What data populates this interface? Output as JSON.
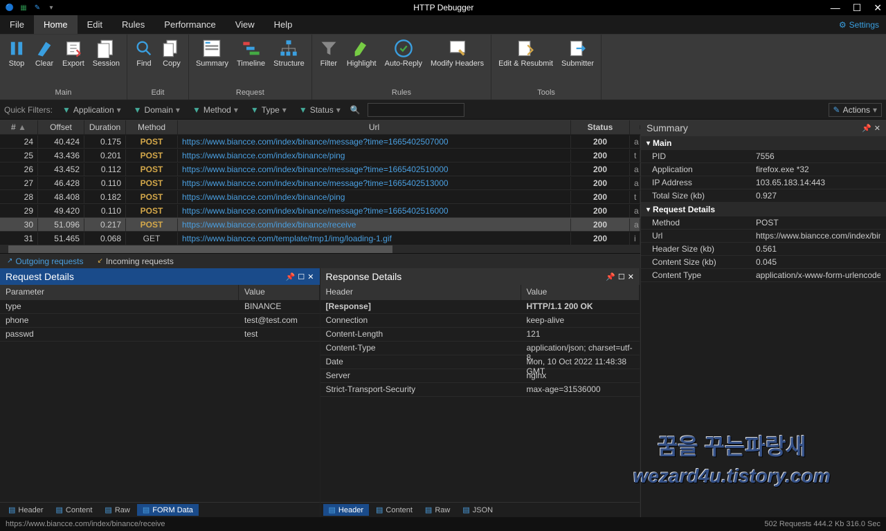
{
  "app": {
    "title": "HTTP Debugger"
  },
  "menu": {
    "items": [
      "File",
      "Home",
      "Edit",
      "Rules",
      "Performance",
      "View",
      "Help"
    ],
    "active": 1,
    "settings": "Settings"
  },
  "ribbon": {
    "groups": [
      {
        "label": "Main",
        "buttons": [
          {
            "name": "stop",
            "label": "Stop"
          },
          {
            "name": "clear",
            "label": "Clear"
          },
          {
            "name": "export",
            "label": "Export"
          },
          {
            "name": "session",
            "label": "Session"
          }
        ]
      },
      {
        "label": "Edit",
        "buttons": [
          {
            "name": "find",
            "label": "Find"
          },
          {
            "name": "copy",
            "label": "Copy"
          }
        ]
      },
      {
        "label": "Request",
        "buttons": [
          {
            "name": "summary",
            "label": "Summary"
          },
          {
            "name": "timeline",
            "label": "Timeline"
          },
          {
            "name": "structure",
            "label": "Structure"
          }
        ]
      },
      {
        "label": "Rules",
        "buttons": [
          {
            "name": "filter",
            "label": "Filter"
          },
          {
            "name": "highlight",
            "label": "Highlight"
          },
          {
            "name": "autoreply",
            "label": "Auto-Reply"
          },
          {
            "name": "modify",
            "label": "Modify\nHeaders"
          }
        ]
      },
      {
        "label": "Tools",
        "buttons": [
          {
            "name": "edit-resubmit",
            "label": "Edit &\nResubmit"
          },
          {
            "name": "submitter",
            "label": "Submitter"
          }
        ]
      }
    ]
  },
  "filters": {
    "label": "Quick Filters:",
    "dropdowns": [
      "Application",
      "Domain",
      "Method",
      "Type",
      "Status"
    ],
    "actions": "Actions"
  },
  "grid": {
    "headers": [
      "#",
      "Offset",
      "Duration",
      "Method",
      "Url",
      "Status"
    ],
    "rows": [
      {
        "n": "24",
        "off": "40.424",
        "dur": "0.175",
        "met": "POST",
        "url": "https://www.biancce.com/index/binance/message?time=1665402507000",
        "stat": "200",
        "e": "a"
      },
      {
        "n": "25",
        "off": "43.436",
        "dur": "0.201",
        "met": "POST",
        "url": "https://www.biancce.com/index/binance/ping",
        "stat": "200",
        "e": "t"
      },
      {
        "n": "26",
        "off": "43.452",
        "dur": "0.112",
        "met": "POST",
        "url": "https://www.biancce.com/index/binance/message?time=1665402510000",
        "stat": "200",
        "e": "a"
      },
      {
        "n": "27",
        "off": "46.428",
        "dur": "0.110",
        "met": "POST",
        "url": "https://www.biancce.com/index/binance/message?time=1665402513000",
        "stat": "200",
        "e": "a"
      },
      {
        "n": "28",
        "off": "48.408",
        "dur": "0.182",
        "met": "POST",
        "url": "https://www.biancce.com/index/binance/ping",
        "stat": "200",
        "e": "t"
      },
      {
        "n": "29",
        "off": "49.420",
        "dur": "0.110",
        "met": "POST",
        "url": "https://www.biancce.com/index/binance/message?time=1665402516000",
        "stat": "200",
        "e": "a"
      },
      {
        "n": "30",
        "off": "51.096",
        "dur": "0.217",
        "met": "POST",
        "url": "https://www.biancce.com/index/binance/receive",
        "stat": "200",
        "e": "a",
        "sel": true
      },
      {
        "n": "31",
        "off": "51.465",
        "dur": "0.068",
        "met": "GET",
        "url": "https://www.biancce.com/template/tmp1/img/loading-1.gif",
        "stat": "200",
        "e": "i"
      }
    ]
  },
  "reqtabs": {
    "outgoing": "Outgoing requests",
    "incoming": "Incoming requests"
  },
  "reqdetails": {
    "title": "Request Details",
    "headers": [
      "Parameter",
      "Value"
    ],
    "rows": [
      {
        "k": "type",
        "v": "BINANCE"
      },
      {
        "k": "phone",
        "v": "test@test.com"
      },
      {
        "k": "passwd",
        "v": "test"
      }
    ],
    "tabs": [
      "Header",
      "Content",
      "Raw",
      "FORM Data"
    ],
    "active_tab": 3
  },
  "respdetails": {
    "title": "Response Details",
    "headers": [
      "Header",
      "Value"
    ],
    "rows": [
      {
        "k": "[Response]",
        "v": "HTTP/1.1 200 OK",
        "bold": true
      },
      {
        "k": "Connection",
        "v": "keep-alive"
      },
      {
        "k": "Content-Length",
        "v": "121"
      },
      {
        "k": "Content-Type",
        "v": "application/json; charset=utf-8"
      },
      {
        "k": "Date",
        "v": "Mon, 10 Oct 2022 11:48:38 GMT"
      },
      {
        "k": "Server",
        "v": "nginx"
      },
      {
        "k": "Strict-Transport-Security",
        "v": "max-age=31536000"
      }
    ],
    "tabs": [
      "Header",
      "Content",
      "Raw",
      "JSON"
    ],
    "active_tab": 0
  },
  "summary": {
    "title": "Summary",
    "sections": [
      {
        "title": "Main",
        "rows": [
          {
            "k": "PID",
            "v": "7556"
          },
          {
            "k": "Application",
            "v": "firefox.exe *32"
          },
          {
            "k": "IP Address",
            "v": "103.65.183.14:443"
          },
          {
            "k": "Total Size (kb)",
            "v": "0.927"
          }
        ]
      },
      {
        "title": "Request Details",
        "rows": [
          {
            "k": "Method",
            "v": "POST"
          },
          {
            "k": "Url",
            "v": "https://www.biancce.com/index/binance/receive"
          },
          {
            "k": "Header Size (kb)",
            "v": "0.561"
          },
          {
            "k": "Content Size (kb)",
            "v": "0.045"
          },
          {
            "k": "Content Type",
            "v": "application/x-www-form-urlencoded"
          }
        ]
      }
    ]
  },
  "watermark": {
    "line1": "꿈을 꾸는파랑새",
    "line2": "wezard4u.tistory.com"
  },
  "status": {
    "left": "https://www.biancce.com/index/binance/receive",
    "right": "502 Requests   444.2 Kb   316.0 Sec"
  }
}
